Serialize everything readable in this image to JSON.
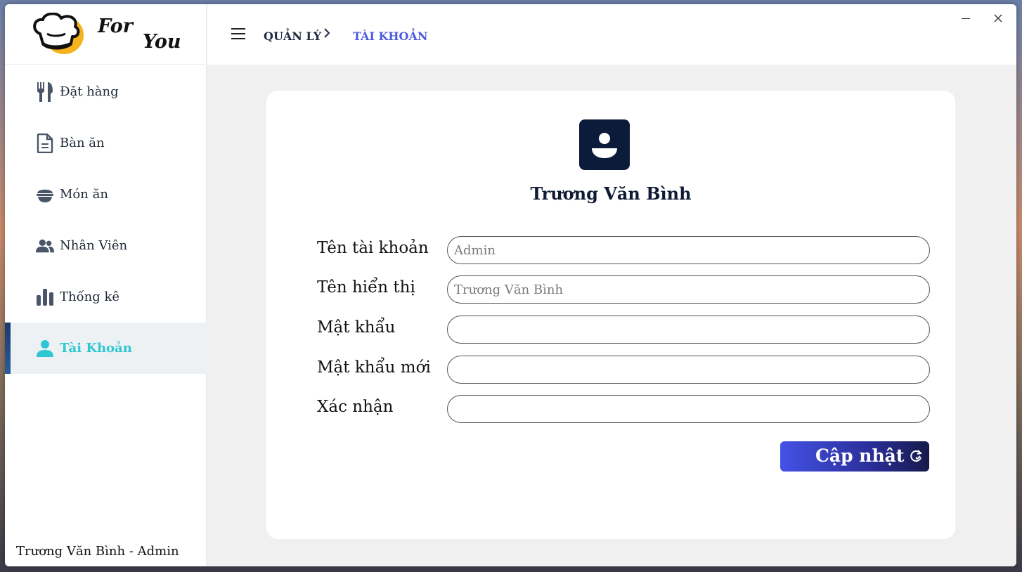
{
  "app": {
    "logo_line1": "For",
    "logo_line2": "You"
  },
  "sidebar": {
    "items": [
      {
        "label": "Đặt hàng",
        "icon": "utensils-icon"
      },
      {
        "label": "Bàn ăn",
        "icon": "document-icon"
      },
      {
        "label": "Món ăn",
        "icon": "bowl-icon"
      },
      {
        "label": "Nhân Viên",
        "icon": "users-icon"
      },
      {
        "label": "Thống kê",
        "icon": "bar-chart-icon"
      },
      {
        "label": "Tài Khoản",
        "icon": "user-icon",
        "active": true
      }
    ],
    "footer_user": "Trương Văn Bình - Admin"
  },
  "header": {
    "breadcrumb_parent": "QUẢN LÝ",
    "breadcrumb_current": "TÀI KHOẢN"
  },
  "account": {
    "display_name": "Trương Văn Bình",
    "fields": [
      {
        "label": "Tên tài khoản",
        "value": "",
        "placeholder": "Admin"
      },
      {
        "label": "Tên hiển thị",
        "value": "",
        "placeholder": "Trương Văn Bình"
      },
      {
        "label": "Mật khẩu",
        "value": "",
        "placeholder": ""
      },
      {
        "label": "Mật khẩu mới",
        "value": "",
        "placeholder": ""
      },
      {
        "label": "Xác nhận",
        "value": "",
        "placeholder": ""
      }
    ],
    "update_label": "Cập nhật"
  },
  "colors": {
    "accent": "#4b5bdc",
    "active_nav": "#2ec7d4",
    "avatar_bg": "#0d1b3a"
  }
}
